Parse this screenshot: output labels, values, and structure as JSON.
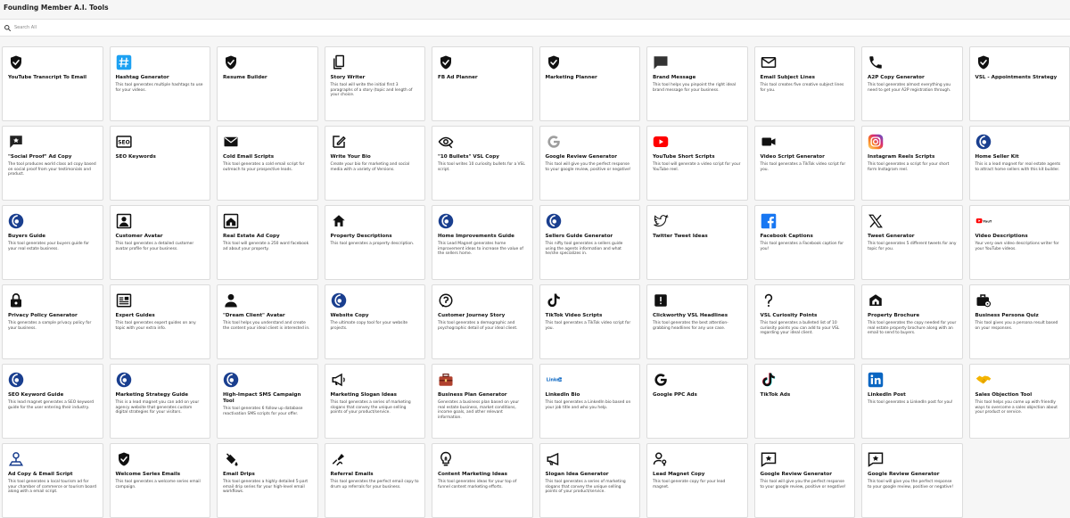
{
  "header": {
    "title": "Founding Member A.I. Tools"
  },
  "search": {
    "placeholder": "Search All"
  },
  "tools": [
    {
      "title": "YouTube Transcript To Email",
      "desc": "",
      "icon": "shield-icon"
    },
    {
      "title": "Hashtag Generator",
      "desc": "This tool generates multiple hashtags to use for your videos.",
      "icon": "hashtag-icon"
    },
    {
      "title": "Resume Builder",
      "desc": "",
      "icon": "shield-icon"
    },
    {
      "title": "Story Writer",
      "desc": "This tool will write the initial first 3 paragraphs of a story (topic and length of your choice.",
      "icon": "pages-icon"
    },
    {
      "title": "FB Ad Planner",
      "desc": "",
      "icon": "shield-icon"
    },
    {
      "title": "Marketing Planner",
      "desc": "",
      "icon": "shield-icon"
    },
    {
      "title": "Brand Message",
      "desc": "This tool helps you pinpoint the right ideal brand message for your business.",
      "icon": "message-icon"
    },
    {
      "title": "Email Subject Lines",
      "desc": "This tool creates five creative subject lines for you.",
      "icon": "mail-outline-icon"
    },
    {
      "title": "A2P Copy Generator",
      "desc": "This tool generates almost everything you need to get your A2P registration through.",
      "icon": "phone-icon"
    },
    {
      "title": "VSL - Appointments Strategy",
      "desc": "",
      "icon": "shield-icon"
    },
    {
      "title": "\"Social Proof\" Ad Copy",
      "desc": "The tool produces world class ad copy based on social proof from your testimonials and product.",
      "icon": "star-message-icon"
    },
    {
      "title": "SEO Keywords",
      "desc": "",
      "icon": "seo-icon"
    },
    {
      "title": "Cold Email Scripts",
      "desc": "This tool generates a cold email script for outreach to your prospective leads.",
      "icon": "mail-icon"
    },
    {
      "title": "Write Your Bio",
      "desc": "Create your bio for marketing and social media with a variety of Versions.",
      "icon": "edit-icon"
    },
    {
      "title": "\"10 Bullets\" VSL Copy",
      "desc": "This tool writes 10 curiosity bullets for a VSL script.",
      "icon": "eye-icon"
    },
    {
      "title": "Google Review Generator",
      "desc": "This tool will give you the perfect response to your google review, positive or negative!",
      "icon": "google-gray-icon"
    },
    {
      "title": "YouTube Short Scripts",
      "desc": "This tool will generate a video script for your YouTube reel.",
      "icon": "youtube-icon"
    },
    {
      "title": "Video Script Generator",
      "desc": "This tool generates a TikTok video script for you.",
      "icon": "video-camera-icon"
    },
    {
      "title": "Instagram Reels Scripts",
      "desc": "This tool generates a script for your short form Instagram reel.",
      "icon": "instagram-icon"
    },
    {
      "title": "Home Seller Kit",
      "desc": "This is a lead magnet for real estate agents to attract home sellers with this kit builder.",
      "icon": "brand-logo-icon"
    },
    {
      "title": "Buyers Guide",
      "desc": "This tool generates your buyers guide for your real estate business.",
      "icon": "brand-logo-icon"
    },
    {
      "title": "Customer Avatar",
      "desc": "This tool generates a detailed customer avatar profile for your business.",
      "icon": "portrait-icon"
    },
    {
      "title": "Real Estate Ad Copy",
      "desc": "This tool will generate a 250 word facebook ad about your property.",
      "icon": "house-frame-icon"
    },
    {
      "title": "Property Descriptions",
      "desc": "This tool generates a property description.",
      "icon": "home-icon"
    },
    {
      "title": "Home Improvements Guide",
      "desc": "This Lead Magnet generates home improvement ideas to increase the value of the sellers home.",
      "icon": "brand-logo-icon"
    },
    {
      "title": "Sellers Guide Generator",
      "desc": "This nifty tool generates a sellers guide using the agents information and what he/she specializes in.",
      "icon": "brand-logo-icon"
    },
    {
      "title": "Twitter Tweet Ideas",
      "desc": "",
      "icon": "twitter-icon"
    },
    {
      "title": "Facebook Captions",
      "desc": "This tool generates a Facebook caption for you!",
      "icon": "facebook-icon"
    },
    {
      "title": "Tweet Generator",
      "desc": "This tool generates 5 different tweets for any topic for you.",
      "icon": "x-icon"
    },
    {
      "title": "Video Descriptions",
      "desc": "Your very own video descriptions writer for your YouTube videos.",
      "icon": "youtube-small-icon"
    },
    {
      "title": "Privacy Policy Generator",
      "desc": "This generates a sample privacy policy for your business.",
      "icon": "lock-icon"
    },
    {
      "title": "Expert Guides",
      "desc": "This tool generates expert guides on any topic with your extra info.",
      "icon": "guide-icon"
    },
    {
      "title": "\"Dream Client\" Avatar",
      "desc": "This tool helps you understand and create the content your ideal client is interested in.",
      "icon": "person-icon"
    },
    {
      "title": "Website Copy",
      "desc": "The ultimate copy tool for your website projects.",
      "icon": "brand-logo-icon"
    },
    {
      "title": "Customer Journey Story",
      "desc": "This tool generates a demographic and psychographic detail of your ideal client.",
      "icon": "journey-icon"
    },
    {
      "title": "TikTok Video Scripts",
      "desc": "This tool generates a TikTok video script for you.",
      "icon": "tiktok-icon"
    },
    {
      "title": "Clickworthy VSL Headlines",
      "desc": "This tool generates the best attention-grabbing headlines for any use case.",
      "icon": "alert-icon"
    },
    {
      "title": "VSL Curiosity Points",
      "desc": "This tool generates a bulleted list of 10 curiosity points you can add to your VSL regarding your ideal client.",
      "icon": "question-icon"
    },
    {
      "title": "Property Brochure",
      "desc": "This tool generates the copy needed for your real estate property brochure along with an email to send to buyers.",
      "icon": "brochure-icon"
    },
    {
      "title": "Business Persona Quiz",
      "desc": "This tool gives you a persona result based on your responses.",
      "icon": "briefcase-icon"
    },
    {
      "title": "SEO Keyword Guide",
      "desc": "This lead magnet generates a SEO keyword guide for the user entering their industry.",
      "icon": "brand-logo-icon"
    },
    {
      "title": "Marketing Strategy Guide",
      "desc": "This is a lead magnet you can add on your agency website that generates custom digital strategies for your visitors.",
      "icon": "brand-logo-icon"
    },
    {
      "title": "High-Impact SMS Campaign Tool",
      "desc": "This tool generates 6 follow up database reactivation SMS scripts for your offer.",
      "icon": "brand-logo-icon"
    },
    {
      "title": "Marketing Slogan Ideas",
      "desc": "This tool generates a series of marketing slogans that convey the unique selling points of your product/service.",
      "icon": "megaphone-icon"
    },
    {
      "title": "Business Plan Generator",
      "desc": "Generates a business plan based on your real estate business, market conditions, income goals, and other relevant information.",
      "icon": "business-bag-icon"
    },
    {
      "title": "LinkedIn Bio",
      "desc": "This tool generates a LinkedIn bio based on your job title and who you help.",
      "icon": "linkedin-word-icon"
    },
    {
      "title": "Google PPC Ads",
      "desc": "",
      "icon": "google-icon"
    },
    {
      "title": "TikTok Ads",
      "desc": "",
      "icon": "tiktok-color-icon"
    },
    {
      "title": "LinkedIn Post",
      "desc": "This tool generates a LinkedIn post for you!",
      "icon": "linkedin-icon"
    },
    {
      "title": "Sales Objection Tool",
      "desc": "This tool helps you come up with friendly ways to overcome a sales objection about your product or service.",
      "icon": "handshake-icon"
    },
    {
      "title": "Ad Copy & Email Script",
      "desc": "This tool generates a local tourism ad for your chamber of commerce or tourism board along with a email script.",
      "icon": "location-person-icon"
    },
    {
      "title": "Welcome Series Emails",
      "desc": "This tool generates a welcome series email campaign.",
      "icon": "shield-icon"
    },
    {
      "title": "Email Drips",
      "desc": "This tool generates a highly detailed 5-part email drip series for your high-level email workflows.",
      "icon": "paint-bucket-icon"
    },
    {
      "title": "Referral Emails",
      "desc": "This tool generates the perfect email copy to drum up referrals for your business.",
      "icon": "referral-icon"
    },
    {
      "title": "Content Marketing Ideas",
      "desc": "This tool generates ideas for your top of funnel content marketing efforts.",
      "icon": "bulb-icon"
    },
    {
      "title": "Slogan Idea Generator",
      "desc": "This tool generates a series of marketing slogans that convey the unique selling points of your product/service.",
      "icon": "megaphone-outline-icon"
    },
    {
      "title": "Lead Magnet Copy",
      "desc": "This tool generate copy for your lead magnet.",
      "icon": "person-key-icon"
    },
    {
      "title": "Google Review Generator",
      "desc": "This tool will give you the perfect response to your google review, positive or negative!",
      "icon": "review-star-icon"
    },
    {
      "title": "Google Review Generator",
      "desc": "This tool will give you the perfect response to your google review, positive or negative!",
      "icon": "review-star-icon"
    }
  ]
}
